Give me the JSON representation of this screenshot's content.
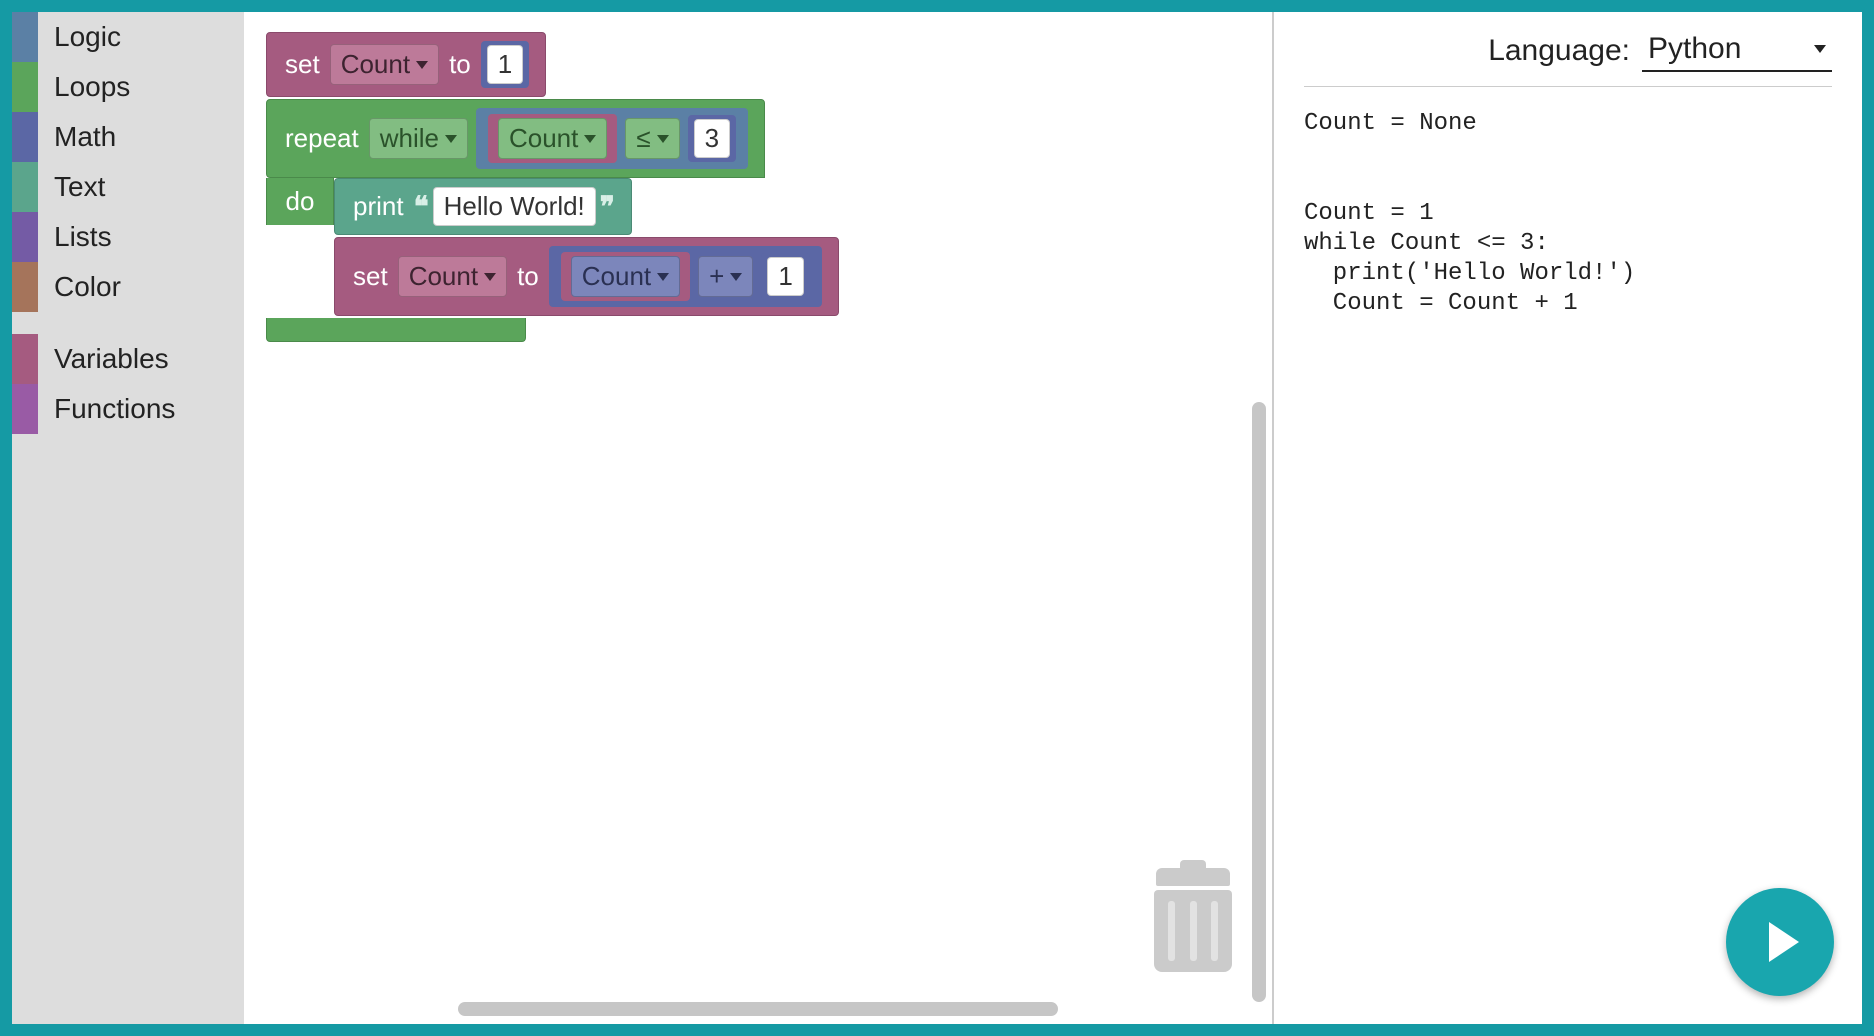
{
  "toolbox": {
    "items": [
      {
        "label": "Logic",
        "swatch": "swatch-logic"
      },
      {
        "label": "Loops",
        "swatch": "swatch-loops"
      },
      {
        "label": "Math",
        "swatch": "swatch-math"
      },
      {
        "label": "Text",
        "swatch": "swatch-text"
      },
      {
        "label": "Lists",
        "swatch": "swatch-lists"
      },
      {
        "label": "Color",
        "swatch": "swatch-color"
      }
    ],
    "items2": [
      {
        "label": "Variables",
        "swatch": "swatch-variables"
      },
      {
        "label": "Functions",
        "swatch": "swatch-functions"
      }
    ]
  },
  "blocks": {
    "set1": {
      "keyword_set": "set",
      "var": "Count",
      "keyword_to": "to",
      "value": "1"
    },
    "loop": {
      "keyword_repeat": "repeat",
      "mode": "while",
      "cond": {
        "left_var": "Count",
        "op": "≤",
        "right_val": "3"
      },
      "keyword_do": "do"
    },
    "print": {
      "keyword": "print",
      "text": "Hello World!"
    },
    "set2": {
      "keyword_set": "set",
      "var": "Count",
      "keyword_to": "to",
      "expr": {
        "left_var": "Count",
        "op": "+",
        "right_val": "1"
      }
    }
  },
  "codepanel": {
    "language_label": "Language:",
    "language_value": "Python",
    "code": "Count = None\n\n\nCount = 1\nwhile Count <= 3:\n  print('Hello World!')\n  Count = Count + 1"
  },
  "colors": {
    "frame": "#159aa4",
    "logic": "#5b80a5",
    "loops": "#5ba55b",
    "math": "#5b67a5",
    "text": "#5ba58c",
    "lists": "#745ba5",
    "color": "#a5745b",
    "variables": "#a55b80",
    "functions": "#995ba5"
  }
}
